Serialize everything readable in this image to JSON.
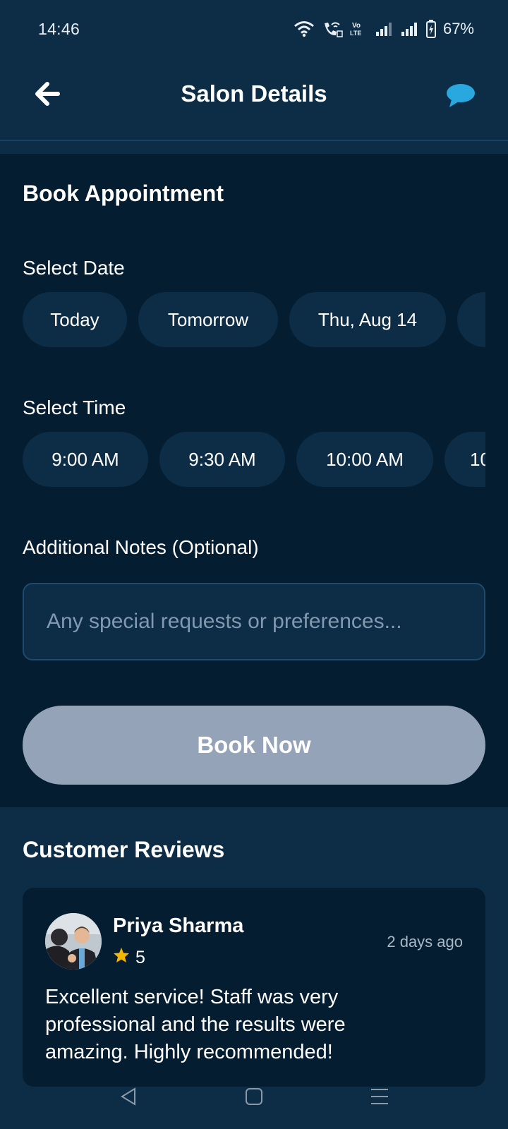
{
  "status_bar": {
    "time": "14:46",
    "battery": "67%"
  },
  "app_bar": {
    "title": "Salon Details",
    "back_icon": "arrow-left-icon",
    "chat_icon": "chat-bubble-icon"
  },
  "booking": {
    "title": "Book Appointment",
    "date_label": "Select Date",
    "dates": [
      "Today",
      "Tomorrow",
      "Thu, Aug 14",
      ""
    ],
    "time_label": "Select Time",
    "times": [
      "9:00 AM",
      "9:30 AM",
      "10:00 AM",
      "10"
    ],
    "notes_label": "Additional Notes (Optional)",
    "notes_placeholder": "Any special requests or preferences...",
    "notes_value": "",
    "book_button": "Book Now"
  },
  "reviews": {
    "title": "Customer Reviews",
    "items": [
      {
        "name": "Priya Sharma",
        "rating": "5",
        "time_ago": "2 days ago",
        "text": "Excellent service! Staff was very professional and the results were amazing. Highly recommended!"
      }
    ]
  },
  "colors": {
    "header_bg": "#0d2d46",
    "section_bg": "#041d30",
    "chip_bg": "#0d2d46",
    "button_disabled": "#94a3b8",
    "accent": "#29a8e0",
    "star": "#f5b800"
  }
}
